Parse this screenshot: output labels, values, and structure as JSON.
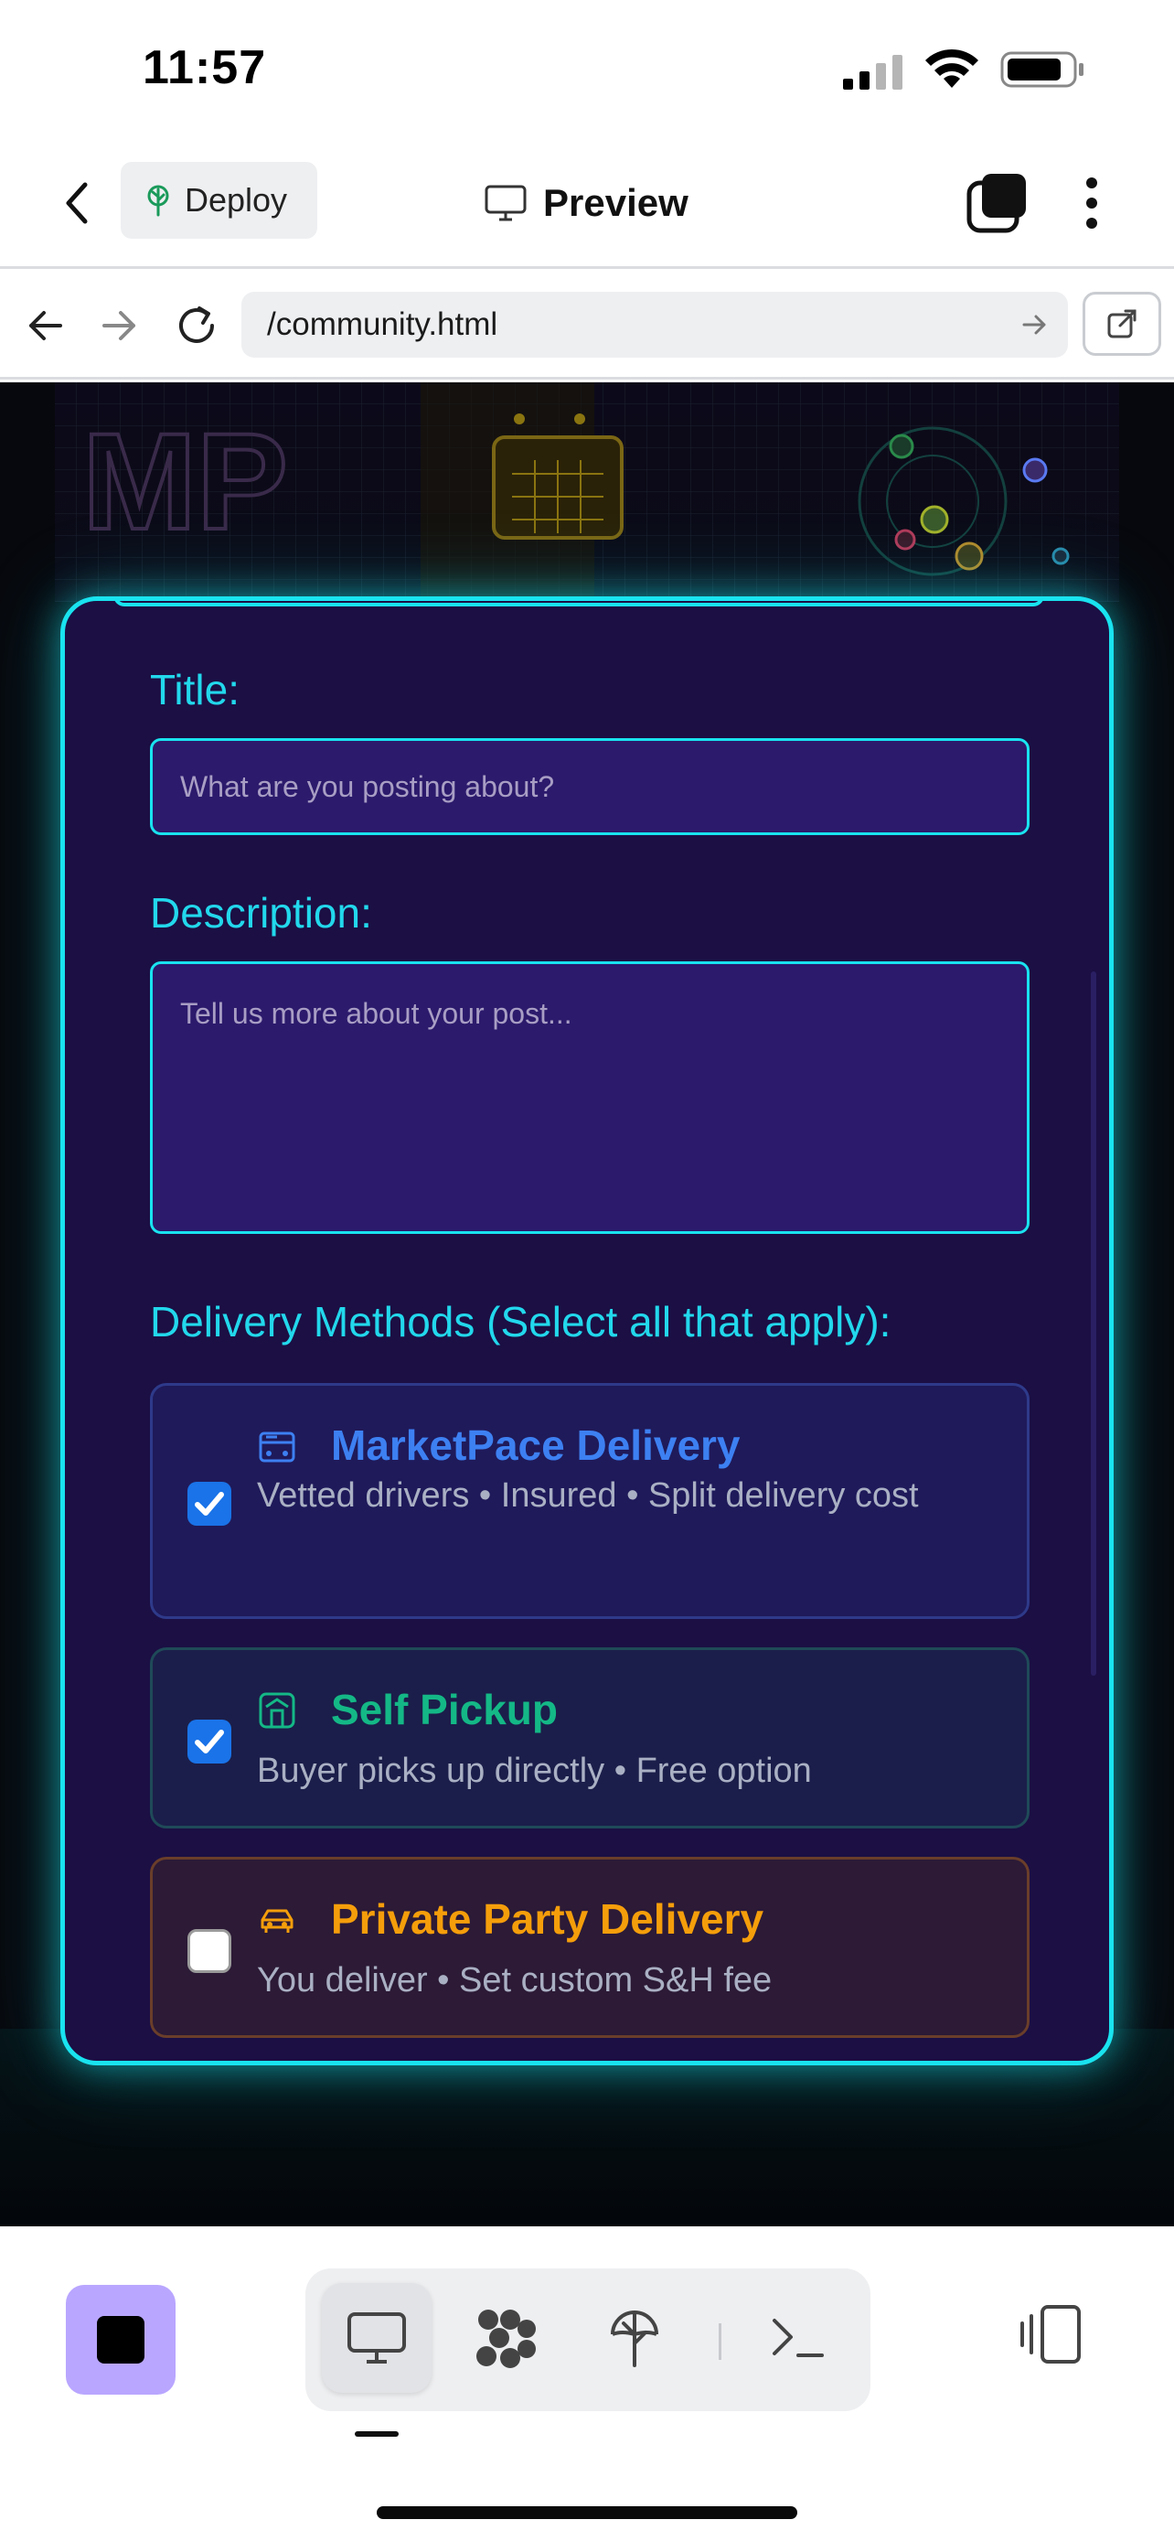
{
  "status_bar": {
    "time": "11:57"
  },
  "header": {
    "deploy_label": "Deploy",
    "preview_label": "Preview"
  },
  "url_bar": {
    "url": "/community.html"
  },
  "form": {
    "title_label": "Title:",
    "title_placeholder": "What are you posting about?",
    "description_label": "Description:",
    "description_placeholder": "Tell us more about your post...",
    "delivery_label": "Delivery Methods (Select all that apply):",
    "options": [
      {
        "icon": "van-icon",
        "title": "MarketPace Delivery",
        "desc": "Vetted drivers • Insured • Split delivery cost",
        "checked": true,
        "color": "#3d80f2"
      },
      {
        "icon": "store-icon",
        "title": "Self Pickup",
        "desc": "Buyer picks up directly • Free option",
        "checked": true,
        "color": "#14b886"
      },
      {
        "icon": "car-icon",
        "title": "Private Party Delivery",
        "desc": "You deliver • Set custom S&H fee",
        "checked": false,
        "color": "#f59e0b"
      }
    ]
  },
  "colors": {
    "accent_cyan": "#19e3ef",
    "card_bg": "#1b0f44",
    "checkbox_blue": "#1a73e8",
    "stop_button": "#b9a6ff"
  }
}
